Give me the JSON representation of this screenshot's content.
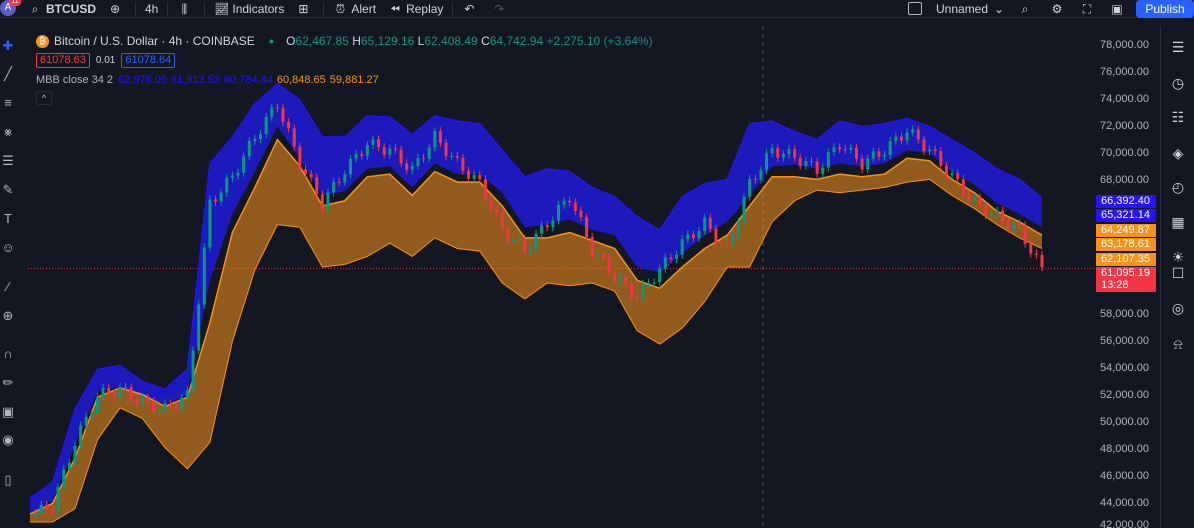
{
  "topbar": {
    "avatar_letter": "A",
    "avatar_badge": "11",
    "symbol": "BTCUSD",
    "interval": "4h",
    "indicators_label": "Indicators",
    "alert_label": "Alert",
    "replay_label": "Replay",
    "layout_name": "Unnamed",
    "publish_label": "Publish"
  },
  "legend": {
    "title": "Bitcoin / U.S. Dollar · 4h · COINBASE",
    "ohlc": {
      "o_key": "O",
      "o": "62,467.85",
      "h_key": "H",
      "h": "65,129.16",
      "l_key": "L",
      "l": "62,408.49",
      "c_key": "C",
      "c": "64,742.94",
      "change": "+2,275.10 (+3.64%)"
    },
    "sell_price": "61078.63",
    "spread": "0.01",
    "buy_price": "61078.64",
    "indicator": {
      "name": "MBB close 34 2",
      "v1": "62,978.05",
      "v2": "61,913.53",
      "v3": "60,784.84",
      "v4": "60,848.65",
      "v5": "59,881.27"
    },
    "collapse_symbol": "^"
  },
  "price_scale": {
    "ticks": [
      "78,000.00",
      "76,000.00",
      "74,000.00",
      "72,000.00",
      "70,000.00",
      "68,000.00",
      "58,000.00",
      "56,000.00",
      "54,000.00",
      "52,000.00",
      "50,000.00",
      "48,000.00",
      "46,000.00",
      "44,000.00",
      "42,000.00"
    ],
    "tags": [
      {
        "value": "66,392.40",
        "color": "#2413ff"
      },
      {
        "value": "65,321.14",
        "color": "#2413ff"
      },
      {
        "value": "64,249.87",
        "color": "#f7931a"
      },
      {
        "value": "63,178.61",
        "color": "#f7931a"
      },
      {
        "value": "62,107.35",
        "color": "#f7931a"
      },
      {
        "value": "61,095.19",
        "color": "#f23645"
      },
      {
        "value": "13:28",
        "color": "#f23645"
      }
    ]
  },
  "colors": {
    "background": "#131722",
    "upper_band": "#1e1bd6",
    "lower_band": "#f7931a",
    "candle_up": "#089981",
    "candle_down": "#f23645",
    "accent": "#2962ff"
  },
  "icons": {
    "left": [
      "crosshair-icon",
      "trend-line-icon",
      "horizontal-lines-icon",
      "pattern-icon",
      "fib-icon",
      "brush-icon",
      "text-icon",
      "emoji-icon",
      "ruler-icon",
      "zoom-in-icon",
      "magnet-icon",
      "lock-drawing-icon",
      "lock-icon",
      "eye-icon",
      "trash-icon"
    ],
    "right": [
      "watchlist-icon",
      "alerts-clock-icon",
      "data-window-icon",
      "layers-icon",
      "hotlist-icon",
      "calendar-icon",
      "ideas-bulb-icon",
      "chat-icon",
      "signal-icon",
      "bell-icon"
    ]
  },
  "chart_data": {
    "type": "line",
    "ylim": [
      42000,
      78000
    ],
    "series": [
      {
        "name": "price",
        "values": [
          42500,
          43200,
          48000,
          51500,
          52000,
          51000,
          50500,
          51500,
          66000,
          68000,
          71000,
          73500,
          69000,
          66000,
          68500,
          70500,
          70000,
          68500,
          71000,
          69000,
          67500,
          64000,
          62500,
          64500,
          66500,
          62500,
          60500,
          59000,
          61000,
          63000,
          64500,
          62500,
          67500,
          70000,
          69500,
          68500,
          70500,
          69000,
          70000,
          71500,
          70000,
          68000,
          66000,
          65000,
          64000,
          61000
        ]
      },
      {
        "name": "upper_band_top",
        "values": [
          43800,
          45000,
          50500,
          53500,
          53800,
          52600,
          52000,
          53500,
          69000,
          71000,
          73500,
          75000,
          73800,
          71000,
          71000,
          72600,
          72500,
          71200,
          72600,
          72200,
          72000,
          70000,
          68000,
          68600,
          68400,
          67200,
          66500,
          65000,
          64000,
          66500,
          67500,
          67800,
          72000,
          72200,
          71400,
          70800,
          72200,
          71800,
          72000,
          72400,
          71800,
          70800,
          69800,
          68600,
          67800,
          66400
        ]
      },
      {
        "name": "upper_band_bottom",
        "values": [
          42600,
          43600,
          47800,
          51800,
          52200,
          51600,
          50800,
          51600,
          60200,
          65200,
          68400,
          71800,
          69400,
          66600,
          66900,
          68600,
          68800,
          67200,
          69000,
          68200,
          68200,
          66800,
          64200,
          64400,
          64800,
          64000,
          63600,
          61200,
          60800,
          62200,
          63600,
          64600,
          66600,
          68800,
          68900,
          68600,
          69000,
          68800,
          69000,
          70000,
          69800,
          68400,
          67400,
          66000,
          65200,
          64200
        ]
      },
      {
        "name": "lower_band_top",
        "values": [
          42600,
          43400,
          46800,
          51400,
          52100,
          51600,
          50700,
          51400,
          57000,
          63800,
          67200,
          70800,
          68800,
          65800,
          66200,
          68000,
          68200,
          66600,
          68400,
          67600,
          67600,
          65800,
          63400,
          63400,
          63800,
          63200,
          62600,
          60200,
          59600,
          61200,
          62600,
          63600,
          65800,
          68000,
          68000,
          67800,
          68200,
          68000,
          68200,
          69400,
          69200,
          67800,
          66800,
          65400,
          64600,
          63600
        ]
      },
      {
        "name": "lower_band_bottom",
        "values": [
          42000,
          42000,
          43000,
          48200,
          50600,
          49800,
          47600,
          46000,
          48000,
          55600,
          61000,
          64400,
          64200,
          61200,
          61400,
          62000,
          63000,
          62000,
          63400,
          62600,
          62400,
          60000,
          58800,
          60000,
          59800,
          60000,
          59400,
          56400,
          55400,
          56600,
          58600,
          61200,
          61200,
          64600,
          66200,
          67000,
          66800,
          67000,
          67200,
          67600,
          67800,
          66600,
          65600,
          64400,
          63400,
          62600
        ]
      }
    ]
  }
}
